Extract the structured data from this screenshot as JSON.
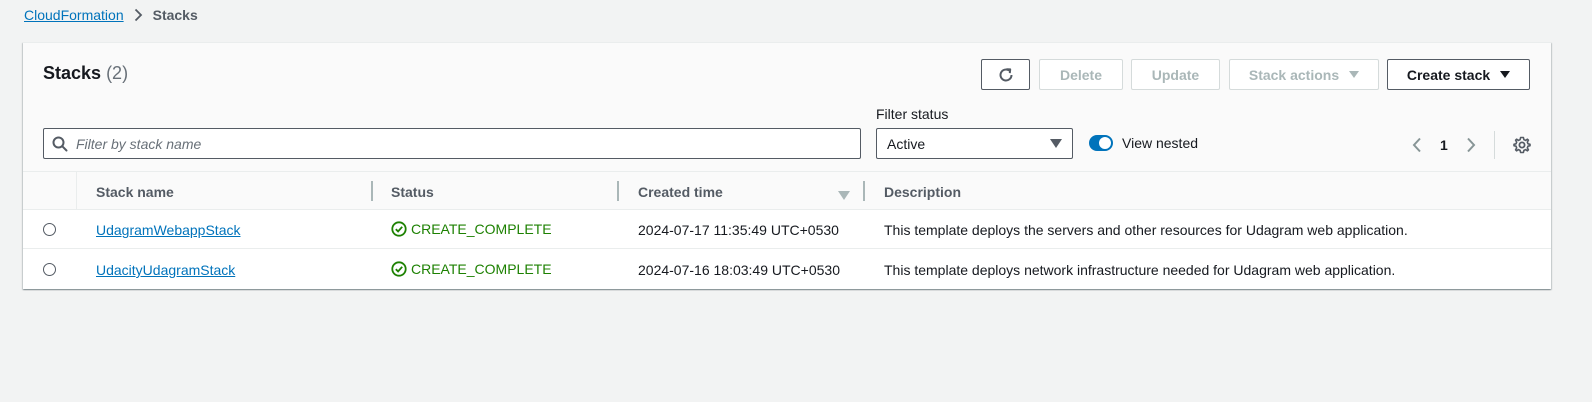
{
  "breadcrumb": {
    "root": "CloudFormation",
    "current": "Stacks"
  },
  "panel": {
    "title": "Stacks",
    "count": "(2)"
  },
  "toolbar": {
    "delete_label": "Delete",
    "update_label": "Update",
    "stack_actions_label": "Stack actions",
    "create_stack_label": "Create stack"
  },
  "filters": {
    "search_placeholder": "Filter by stack name",
    "status_label": "Filter status",
    "status_value": "Active",
    "view_nested_label": "View nested",
    "view_nested_on": true
  },
  "pagination": {
    "current_page": "1"
  },
  "table": {
    "headers": {
      "name": "Stack name",
      "status": "Status",
      "created": "Created time",
      "description": "Description"
    },
    "rows": [
      {
        "name": "UdagramWebappStack",
        "status": "CREATE_COMPLETE",
        "created": "2024-07-17 11:35:49 UTC+0530",
        "description": "This template deploys the servers and other resources for Udagram web application."
      },
      {
        "name": "UdacityUdagramStack",
        "status": "CREATE_COMPLETE",
        "created": "2024-07-16 18:03:49 UTC+0530",
        "description": "This template deploys network infrastructure needed for Udagram web application."
      }
    ]
  },
  "colors": {
    "link": "#0073bb",
    "success": "#1d8102",
    "toggle_on": "#0073bb"
  },
  "icons": {
    "refresh": "refresh-icon",
    "search": "search-icon",
    "prev": "chevron-left-icon",
    "next": "chevron-right-icon",
    "settings": "gear-icon",
    "status_ok": "check-circle-icon"
  }
}
